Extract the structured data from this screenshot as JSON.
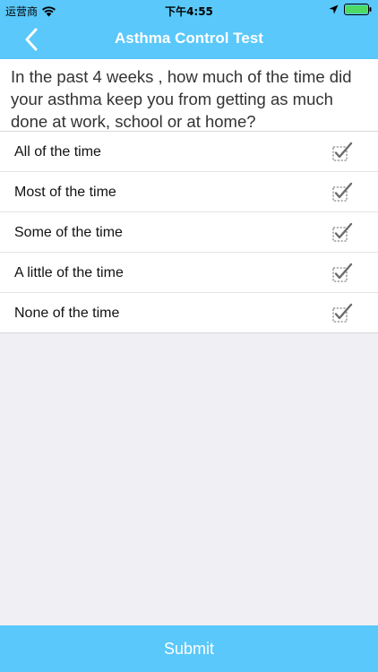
{
  "status_bar": {
    "carrier": "运营商",
    "time": "下午4:55"
  },
  "nav": {
    "title": "Asthma Control Test"
  },
  "question": {
    "text": "In the past 4 weeks , how much of the time did your asthma keep you from getting as much done at work, school or at home?"
  },
  "options": [
    {
      "label": "All of the time"
    },
    {
      "label": "Most of the time"
    },
    {
      "label": "Some of the time"
    },
    {
      "label": "A little of the time"
    },
    {
      "label": "None of the time"
    }
  ],
  "submit": {
    "label": "Submit"
  },
  "colors": {
    "accent": "#5ac8fa",
    "background": "#efeff4"
  }
}
